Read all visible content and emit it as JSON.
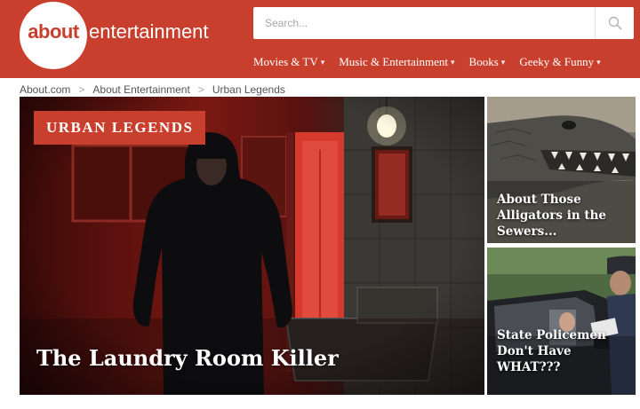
{
  "brand": {
    "logo_word": "about",
    "site_word": "entertainment",
    "color_primary": "#c8402d"
  },
  "search": {
    "placeholder": "Search...",
    "button_icon": "search-icon"
  },
  "nav": {
    "items": [
      {
        "label": "Movies & TV",
        "icon": "chevron-down-icon"
      },
      {
        "label": "Music & Entertainment",
        "icon": "chevron-down-icon"
      },
      {
        "label": "Books",
        "icon": "chevron-down-icon"
      },
      {
        "label": "Geeky & Funny",
        "icon": "chevron-down-icon"
      }
    ]
  },
  "breadcrumb": {
    "items": [
      "About.com",
      "About Entertainment",
      "Urban Legends"
    ],
    "separator": ">"
  },
  "hero": {
    "category": "URBAN LEGENDS",
    "title": "The Laundry Room Killer"
  },
  "cards": [
    {
      "title": "About Those Alligators in the Sewers..."
    },
    {
      "title": "State Policemen Don't Have WHAT???"
    }
  ]
}
